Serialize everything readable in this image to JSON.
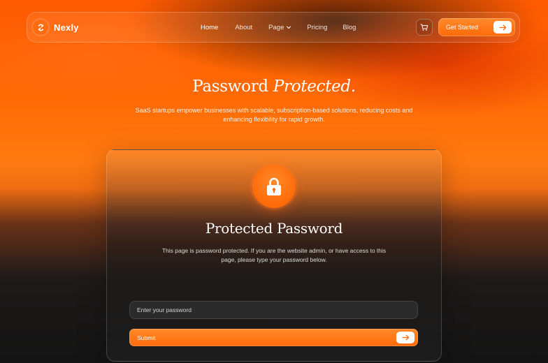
{
  "nav": {
    "brand": "Nexly",
    "items": [
      {
        "label": "Home",
        "active": true
      },
      {
        "label": "About"
      },
      {
        "label": "Page",
        "has_dropdown": true
      },
      {
        "label": "Pricing"
      },
      {
        "label": "Blog"
      }
    ],
    "cart_icon": "cart-icon",
    "cta_label": "Get Started"
  },
  "hero": {
    "title_plain": "Password",
    "title_italic": "Protected.",
    "subtitle": "SaaS startups empower businesses with scalable, subscription-based solutions, reducing costs and enhancing flexibility for rapid growth."
  },
  "card": {
    "icon": "lock-icon",
    "title": "Protected Password",
    "description": "This page is password protected. If you are the website admin, or have access to this page, please type your password below.",
    "input_placeholder": "Enter your password",
    "input_value": "",
    "submit_label": "Submit"
  },
  "colors": {
    "accent": "#ff6a0a",
    "background_dark": "#141414"
  }
}
